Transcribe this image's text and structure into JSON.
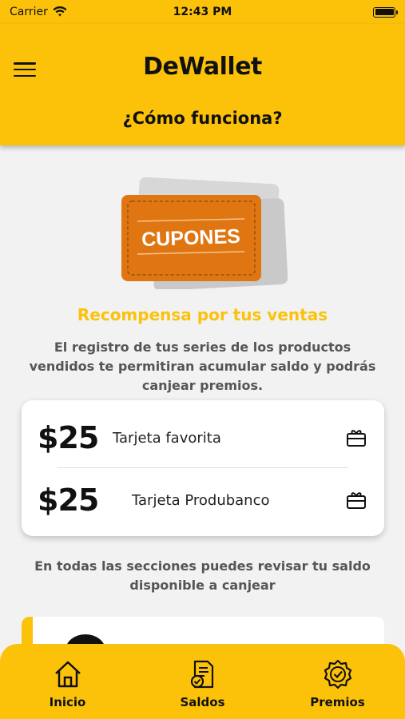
{
  "status": {
    "carrier": "Carrier",
    "time": "12:43 PM"
  },
  "header": {
    "brand": "DeWallet",
    "title": "¿Cómo funciona?"
  },
  "hero": {
    "badge_text": "CUPONES"
  },
  "section": {
    "title": "Recompensa por tus ventas",
    "description": "El registro de tus series de los productos vendidos te permitiran acumular saldo y podrás canjear premios."
  },
  "rewards": [
    {
      "amount": "$25",
      "label": "Tarjeta favorita",
      "icon": "gift-card-icon"
    },
    {
      "amount": "$25",
      "label": "Tarjeta Produbanco",
      "icon": "gift-card-icon"
    }
  ],
  "note": "En todas las secciones puedes revisar tu saldo disponible a canjear",
  "tabs": [
    {
      "label": "Inicio",
      "icon": "home-icon"
    },
    {
      "label": "Saldos",
      "icon": "document-check-icon"
    },
    {
      "label": "Premios",
      "icon": "award-badge-icon"
    }
  ],
  "colors": {
    "accent": "#fcc20a",
    "coupon": "#e07612",
    "text_muted": "#555555"
  }
}
